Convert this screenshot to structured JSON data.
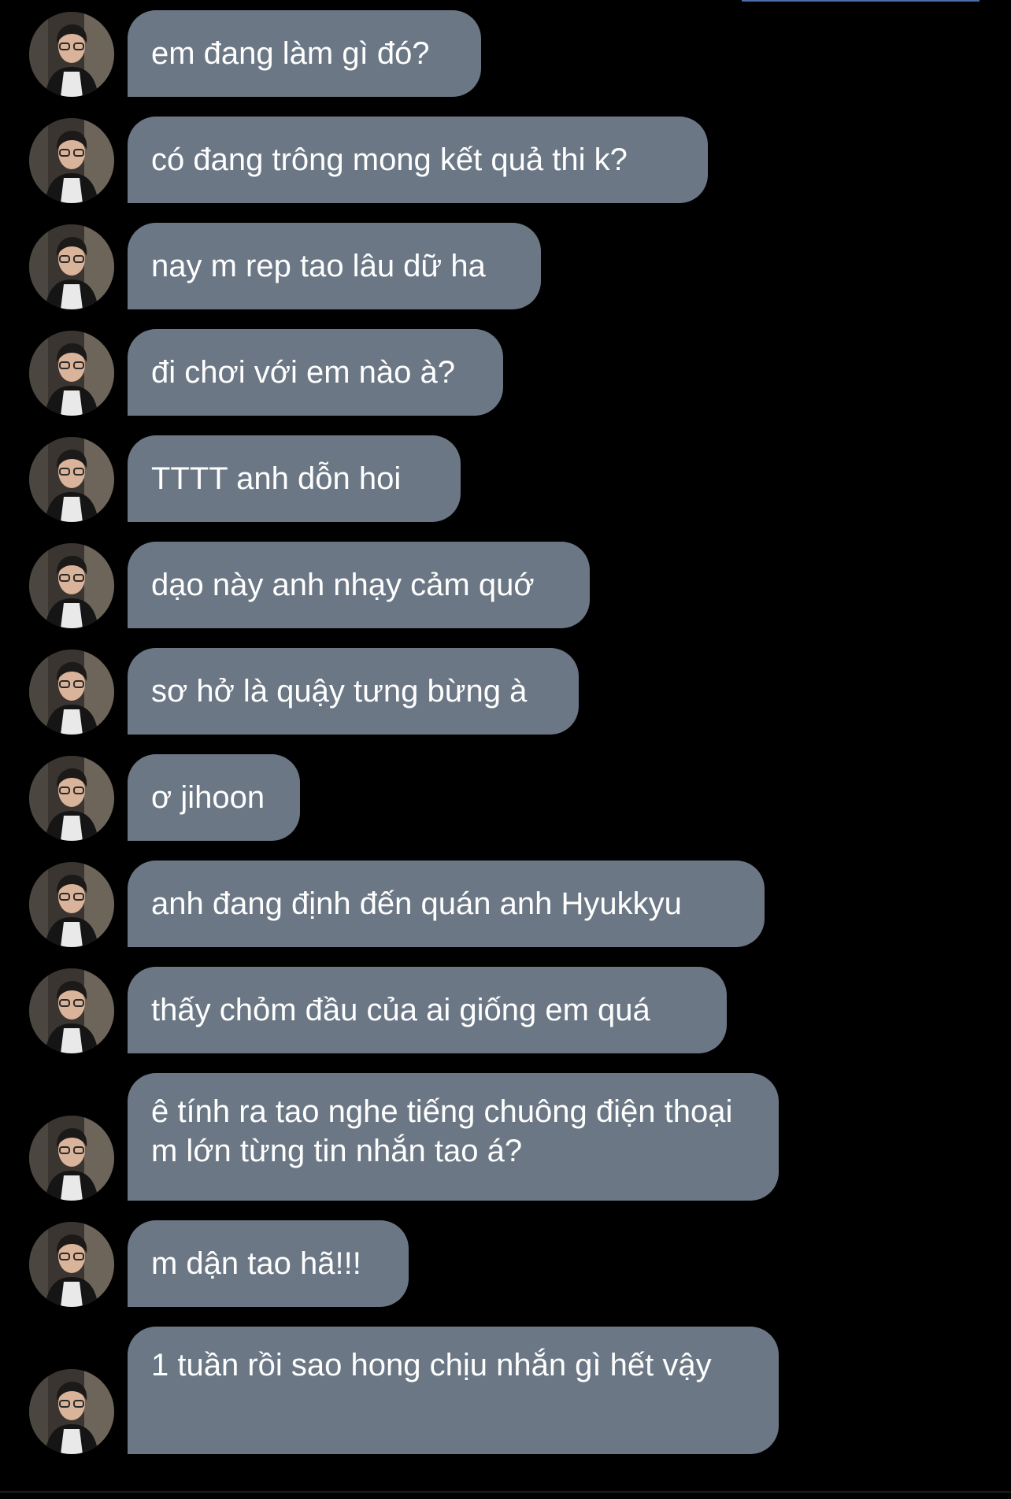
{
  "conversation": {
    "avatar_icon": "user-avatar-photo",
    "colors": {
      "background": "#000000",
      "bubble": "#6b7785",
      "text": "#ffffff"
    },
    "messages": [
      {
        "text": "em đang làm gì đó?"
      },
      {
        "text": "có đang trông mong kết quả thi k?"
      },
      {
        "text": "nay m rep tao lâu dữ ha"
      },
      {
        "text": "đi chơi với em nào à?"
      },
      {
        "text": "TTTT anh dỗn hoi"
      },
      {
        "text": "dạo này anh nhạy cảm quớ"
      },
      {
        "text": "sơ hở là quậy tưng bừng à"
      },
      {
        "text": "ơ jihoon"
      },
      {
        "text": "anh đang định đến quán anh Hyukkyu"
      },
      {
        "text": "thấy chỏm đầu của ai giống em quá"
      },
      {
        "text": "ê tính ra tao nghe tiếng chuông điện thoại m lớn từng tin nhắn tao á?"
      },
      {
        "text": "m dận tao hã!!!"
      },
      {
        "text": "1 tuần rồi sao hong chịu nhắn gì hết vậy"
      }
    ]
  }
}
